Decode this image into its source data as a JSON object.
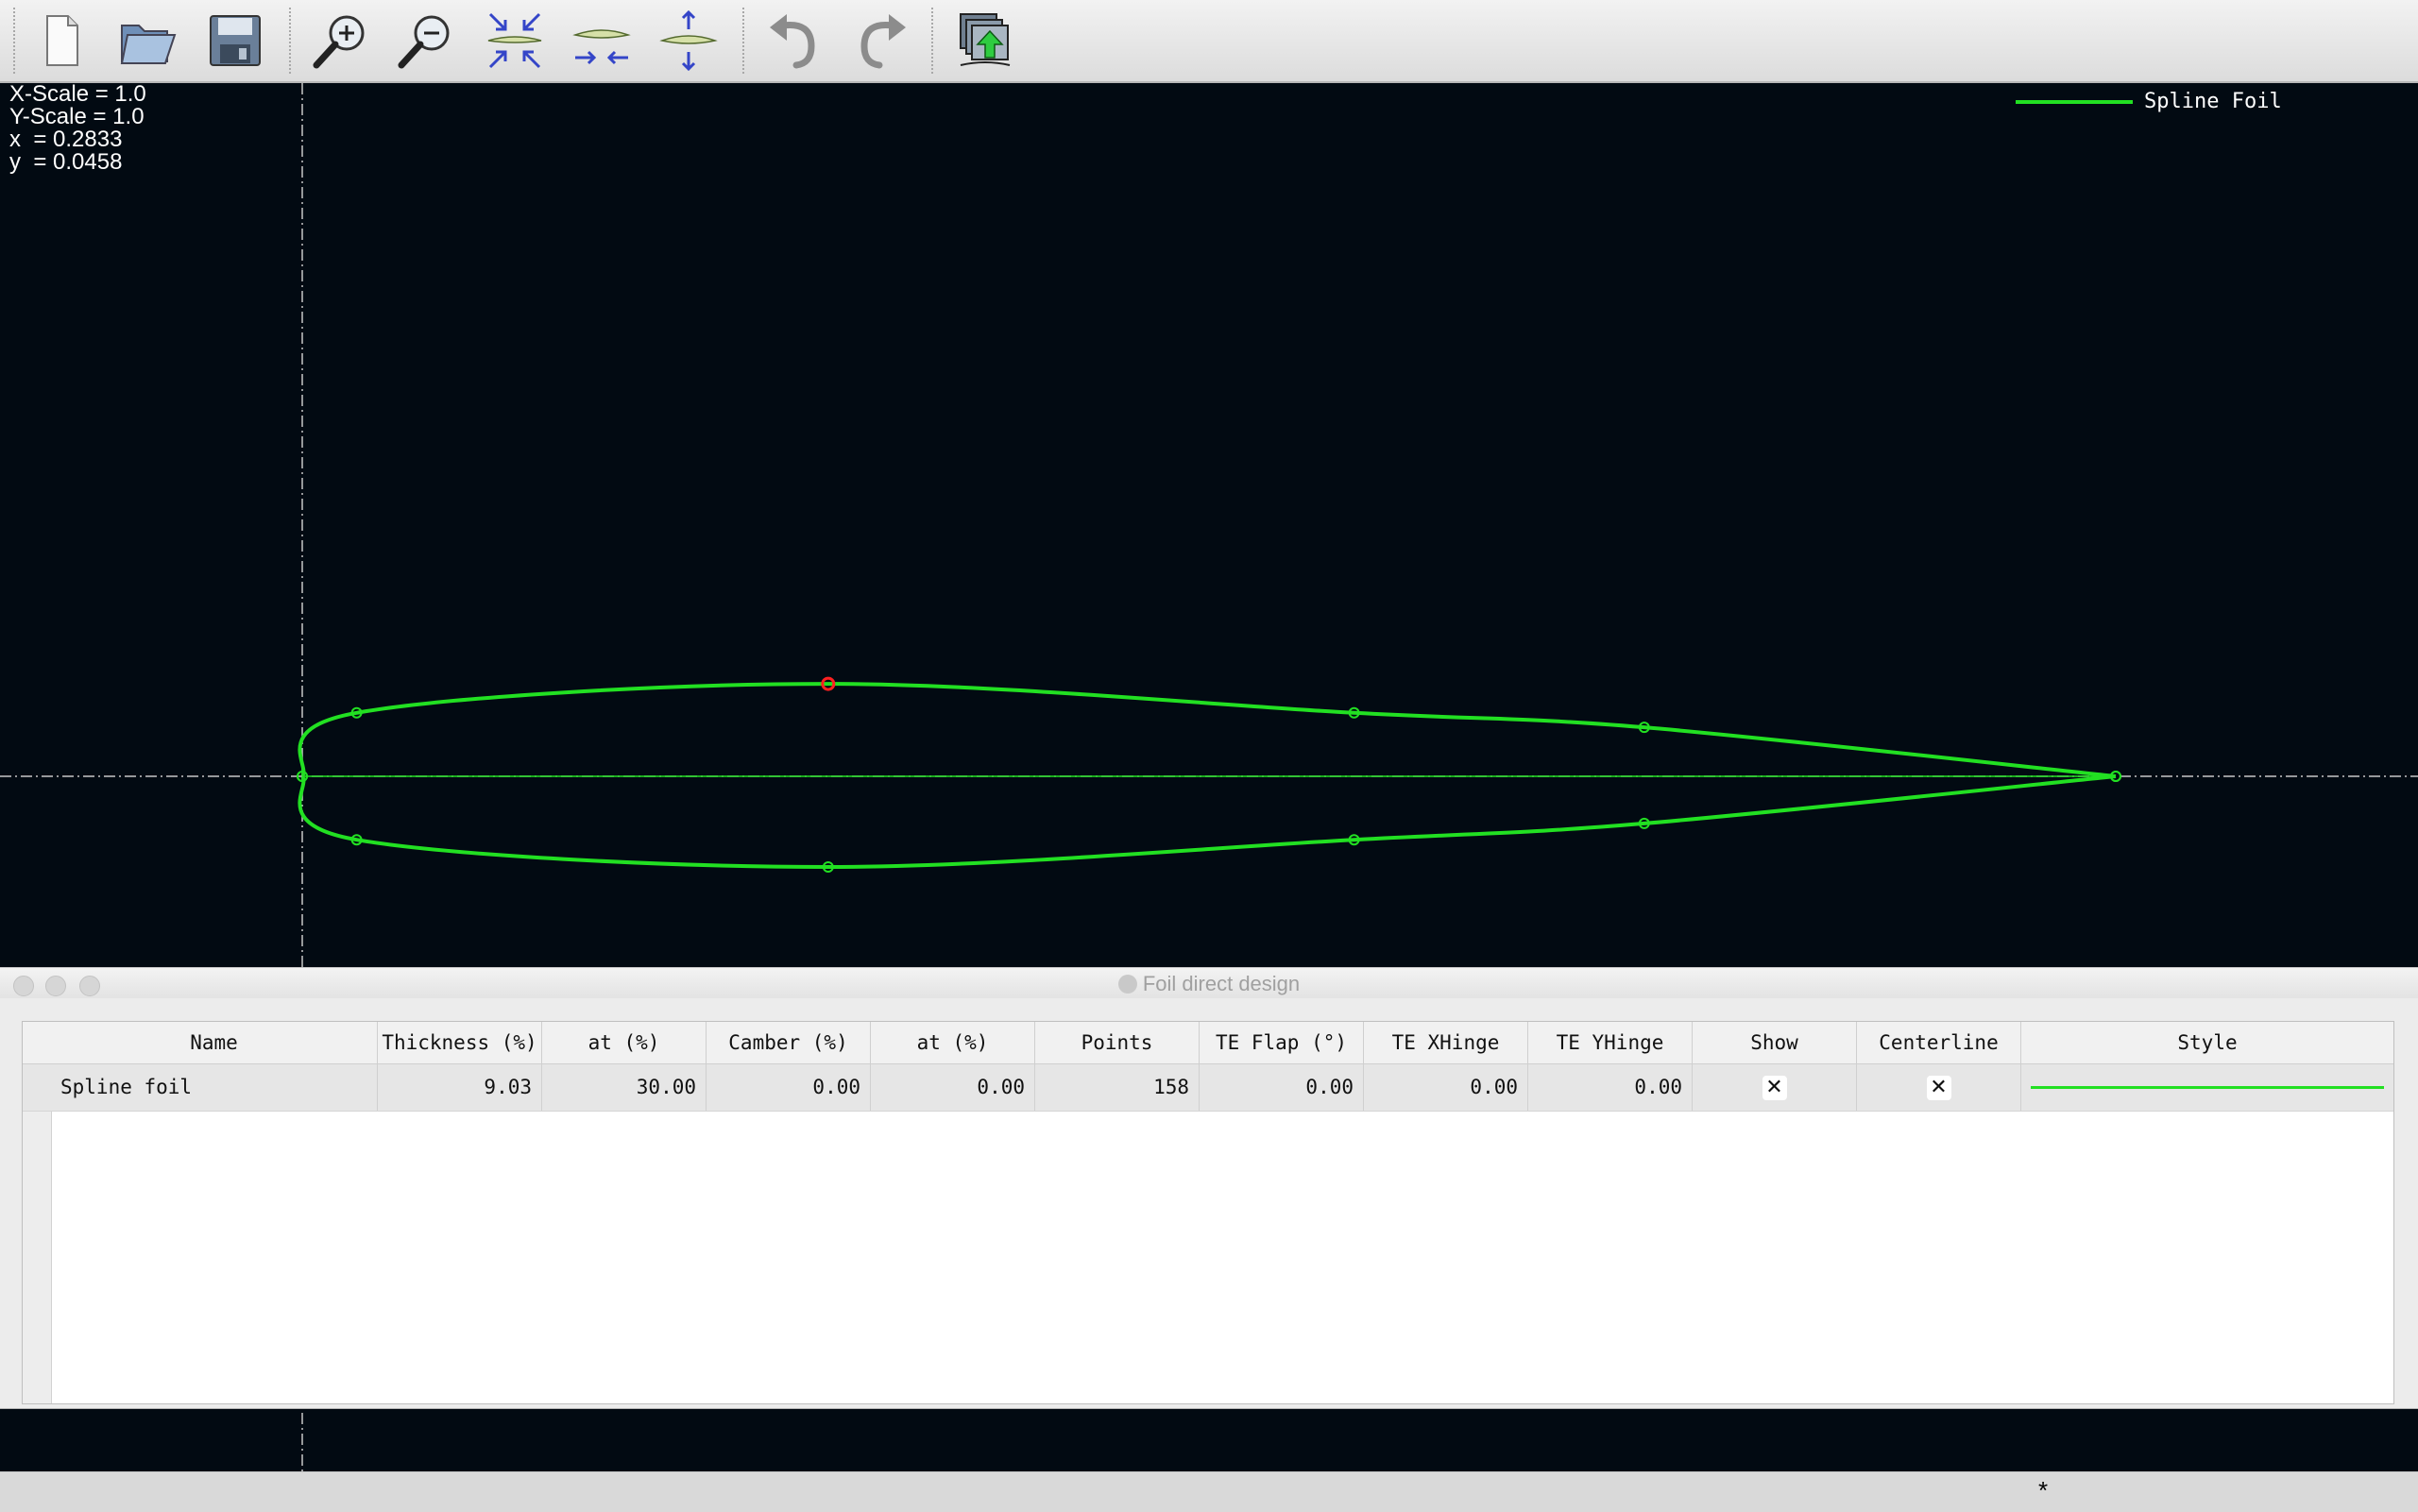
{
  "toolbar": {
    "buttons": [
      {
        "name": "new-file-icon",
        "label": "New"
      },
      {
        "name": "open-folder-icon",
        "label": "Open"
      },
      {
        "name": "save-disk-icon",
        "label": "Save"
      },
      {
        "name": "zoom-in-icon",
        "label": "Zoom in"
      },
      {
        "name": "zoom-out-icon",
        "label": "Zoom out"
      },
      {
        "name": "reset-view-icon",
        "label": "Reset scales"
      },
      {
        "name": "reset-x-scale-icon",
        "label": "Reset X scale"
      },
      {
        "name": "reset-y-scale-icon",
        "label": "Reset Y scale"
      },
      {
        "name": "undo-icon",
        "label": "Undo"
      },
      {
        "name": "redo-icon",
        "label": "Redo"
      },
      {
        "name": "store-foil-icon",
        "label": "Store foil"
      }
    ]
  },
  "view_info": {
    "x_scale_text": "X-Scale = 1.0",
    "y_scale_text": "Y-Scale = 1.0",
    "x_text": "x  = 0.2833",
    "y_text": "y  = 0.0458"
  },
  "legend": {
    "label": "Spline Foil",
    "color": "#22e022"
  },
  "colors": {
    "background": "#020a12",
    "foil": "#22e022",
    "selected_point": "#ff2020",
    "axes": "#c8c8c8"
  },
  "foil": {
    "upper_control_points": [
      [
        0.0,
        0.0
      ],
      [
        0.03,
        0.035
      ],
      [
        0.29,
        0.051
      ],
      [
        0.58,
        0.035
      ],
      [
        0.74,
        0.027
      ],
      [
        1.0,
        0.0
      ]
    ],
    "lower_control_points": [
      [
        0.0,
        0.0
      ],
      [
        0.03,
        -0.035
      ],
      [
        0.29,
        -0.05
      ],
      [
        0.58,
        -0.035
      ],
      [
        0.74,
        -0.026
      ],
      [
        1.0,
        0.0
      ]
    ],
    "selected_point_index": 2
  },
  "panel": {
    "title": "Foil direct design",
    "columns": [
      "Name",
      "Thickness (%)",
      "at (%)",
      "Camber (%)",
      "at (%)",
      "Points",
      "TE Flap (°)",
      "TE XHinge",
      "TE YHinge",
      "Show",
      "Centerline",
      "Style"
    ],
    "rows": [
      {
        "index": "1",
        "name": "Spline foil",
        "thickness": "9.03",
        "thickness_at": "30.00",
        "camber": "0.00",
        "camber_at": "0.00",
        "points": "158",
        "te_flap": "0.00",
        "te_xhinge": "0.00",
        "te_yhinge": "0.00",
        "show": "✕",
        "centerline": "✕"
      }
    ]
  },
  "statusbar": {
    "text": "*"
  }
}
